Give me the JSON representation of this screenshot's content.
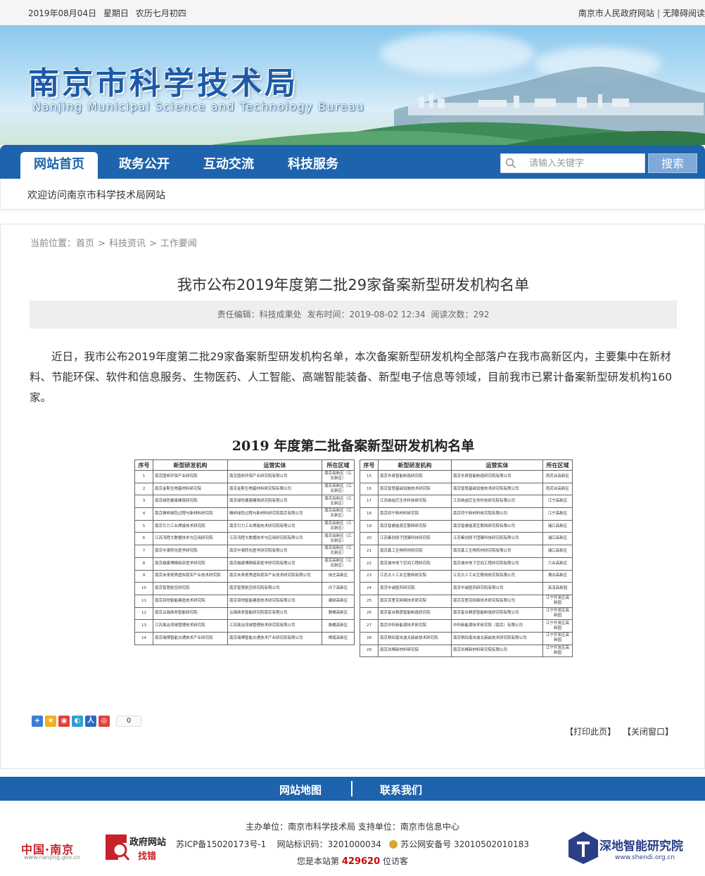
{
  "topbar": {
    "date": "2019年08月04日",
    "weekday": "星期日",
    "lunar": "农历七月初四",
    "gov_link": "南京市人民政府网站",
    "accessibility_link": "无障碍阅读"
  },
  "banner": {
    "title_cn": "南京市科学技术局",
    "title_en": "Nanjing Municipal Science and Technology Bureau"
  },
  "nav": {
    "items": [
      "网站首页",
      "政务公开",
      "互动交流",
      "科技服务"
    ],
    "search_placeholder": "请输入关键字",
    "search_button": "搜索"
  },
  "welcome": "欢迎访问南京市科学技术局网站",
  "breadcrumb": {
    "prefix": "当前位置：",
    "items": [
      "首页",
      "科技资讯",
      "工作要闻"
    ]
  },
  "article": {
    "title": "我市公布2019年度第二批29家备案新型研发机构名单",
    "editor": "责任编辑：科技成果处",
    "publish_time": "发布时间：2019-08-02 12:34",
    "views": "阅读次数：292",
    "body": "近日，我市公布2019年度第二批29家备案新型研发机构名单，本次备案新型研发机构全部落户在我市高新区内，主要集中在新材料、节能环保、软件和信息服务、生物医药、人工智能、高端智能装备、新型电子信息等领域，目前我市已累计备案新型研发机构160家。"
  },
  "doc": {
    "title": "2019 年度第二批备案新型研发机构名单",
    "headers": [
      "序号",
      "新型研发机构",
      "运营实体",
      "所在区域"
    ],
    "left_rows": [
      [
        "1",
        "南京固邦环保产业研究院",
        "南京固邦环保产业研究院有限公司",
        "南京高新区（江北新区）"
      ],
      [
        "2",
        "南京金斯生物基材料研究院",
        "南京金斯生物基材料研究院有限公司",
        "南京高新区（江北新区）"
      ],
      [
        "3",
        "南京绿色健康建筑研究院",
        "南京绿色健康建筑研究院有限公司",
        "南京高新区（江北新区）"
      ],
      [
        "4",
        "南京雅邦绿色过程与新材料研究院",
        "雅邦绿色过程与新材料研究院南京有限公司",
        "南京高新区（江北新区）"
      ],
      [
        "5",
        "南京引力工业焊接技术研究院",
        "南京引力工业焊接技术研究院有限公司",
        "南京高新区（江北新区）"
      ],
      [
        "6",
        "江苏鸿程大数据技术与应用研究院",
        "江苏鸿程大数据技术与应用研究院有限公司",
        "南京高新区（江北新区）"
      ],
      [
        "7",
        "南京中澳转化医学研究院",
        "南京中澳转化医学研究院有限公司",
        "南京高新区（江北新区）"
      ],
      [
        "8",
        "南京融康博精临床医学研究院",
        "南京融康博精临床医学研究院有限公司",
        "南京高新区（江北新区）"
      ],
      [
        "9",
        "南京未来视界虚拟现实产业技术研究院",
        "南京未来视界虚拟现实产业技术研究院有限公司",
        "徐庄高新区"
      ],
      [
        "10",
        "南京智慧航空研究院",
        "南京智慧航空研究院有限公司",
        "白下高新区"
      ],
      [
        "11",
        "南京润地智能建造技术研究院",
        "南京润地智能建造技术研究院有限公司",
        "建邺高新区"
      ],
      [
        "12",
        "南京云瑞商务智能研究院",
        "云瑞商务智能研究院南京有限公司",
        "鼓楼高新区"
      ],
      [
        "13",
        "江苏禹治流域管理技术研究院",
        "江苏禹治流域管理技术研究院有限公司",
        "鼓楼高新区"
      ],
      [
        "14",
        "南京瑞博智能交通技术产业研究院",
        "南京瑞博智能交通技术产业研究院有限公司",
        "栖霞高新区"
      ]
    ],
    "right_rows": [
      [
        "15",
        "南京东奇智能制造研究院",
        "南京东奇智能制造研究院有限公司",
        "雨花台高新区"
      ],
      [
        "16",
        "南京智慧基础设施技术研究院",
        "南京智慧基础设施技术研究院有限公司",
        "雨花台高新区"
      ],
      [
        "17",
        "江苏纳迪芯生命科技研究院",
        "江苏纳迪芯生命科技研究院有限公司",
        "江宁高新区"
      ],
      [
        "18",
        "南京同宁新材料研究院",
        "南京同宁新材料研究院有限公司",
        "江宁高新区"
      ],
      [
        "19",
        "南京智睿能源互联网研究院",
        "南京智睿能源互联网研究院有限公司",
        "浦口高新区"
      ],
      [
        "20",
        "江苏集创原子团簇科技研究院",
        "江苏集创原子团簇科技研究院有限公司",
        "浦口高新区"
      ],
      [
        "21",
        "南京鑫工生物药材研究院",
        "南京鑫工生物药材研究院有限公司",
        "浦口高新区"
      ],
      [
        "22",
        "南京城市地下空间工程研究院",
        "南京城市地下空间工程研究院有限公司",
        "六合高新区"
      ],
      [
        "23",
        "江苏大人工业互联网研究院",
        "江苏大人工业互联网研究院有限公司",
        "溧水高新区"
      ],
      [
        "24",
        "南京中诚医药研究院",
        "南京中诚医药研究院有限公司",
        "高淳高新园"
      ],
      [
        "25",
        "南京克里克网络技术研究院",
        "南京克里克网络技术研究院有限公司",
        "江宁开发区高新园"
      ],
      [
        "26",
        "南京星合精密智能制造研究院",
        "南京星合精密智能制造研究院有限公司",
        "江宁开发区高新园"
      ],
      [
        "27",
        "南京中科新能源技术研究院",
        "中科新能源技术研究院（南京）有限公司",
        "江宁开发区高新园"
      ],
      [
        "28",
        "南京税码毫米波太赫兹技术研究院",
        "南京税码毫米波太赫兹技术研究院有限公司",
        "江宁开发区高新园"
      ],
      [
        "29",
        "南京玖稀新材料研究院",
        "南京玖稀新材料研究院有限公司",
        "江宁开发区高新园"
      ]
    ]
  },
  "share": {
    "count": "0",
    "icons": [
      "share-plus-icon",
      "qzone-icon",
      "weibo-icon",
      "tencent-weibo-icon",
      "renren-icon",
      "kaixin-icon"
    ]
  },
  "tools": {
    "print": "【打印此页】",
    "close": "【关闭窗口】"
  },
  "footer_nav": [
    "网站地图",
    "联系我们"
  ],
  "footer": {
    "host": "主办单位：南京市科学技术局 支持单位：南京市信息中心",
    "icp": "苏ICP备15020173号-1",
    "site_code": "网站标识码：3201000034",
    "police": "苏公网安备号 32010502010183",
    "visitor_prefix": "您是本站第",
    "visitor_count": "429620",
    "visitor_suffix": "位访客",
    "logo_cn": "中国·南京",
    "logo_cn_url": "www.nanjing.gov.cn",
    "gov_logo_top": "政府网站",
    "gov_logo_bottom": "找错"
  },
  "watermark": {
    "name": "深地智能研究院",
    "url": "www.shendi.org.cn"
  },
  "colors": {
    "nav_blue": "#1e63ad",
    "accent_red": "#c30d0d"
  }
}
